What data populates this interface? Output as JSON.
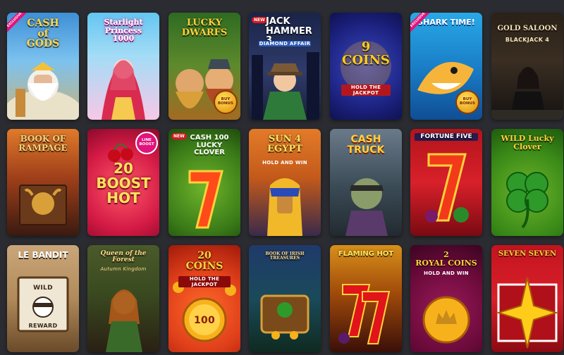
{
  "games": [
    {
      "id": "cash-of-gods",
      "title": "CASH\nof\nGODS",
      "badge": "EXCLUSIVE"
    },
    {
      "id": "starlight-princess-1000",
      "title": "Starlight\nPrincess\n1000"
    },
    {
      "id": "lucky-dwarfs",
      "title": "LUCKY\nDWARFS",
      "bonus": "BUY\nBONUS"
    },
    {
      "id": "jack-hammer-3",
      "title": "JACK\nHAMMER 3",
      "subtitle": "DIAMOND AFFAIR",
      "new": "NEW"
    },
    {
      "id": "9-coins",
      "title": "9\nCOINS",
      "subtitle": "HOLD THE JACKPOT"
    },
    {
      "id": "shark-time",
      "title": "SHARK TIME!",
      "badge": "EXCLUSIVE",
      "bonus": "BUY\nBONUS"
    },
    {
      "id": "gold-saloon-blackjack-4",
      "title": "GOLD SALOON",
      "subtitle": "BLACKJACK 4"
    },
    {
      "id": "book-of-rampage",
      "title": "BOOK OF\nRAMPAGE"
    },
    {
      "id": "20-boost-hot",
      "title": "20\nBOOST\nHOT",
      "boost": "LINE\nBOOST"
    },
    {
      "id": "cash-100-lucky-clover",
      "title": "CASH 100\nLUCKY CLOVER",
      "new": "NEW"
    },
    {
      "id": "sun-of-egypt-4",
      "title": "SUN 4\nEGYPT",
      "subtitle": "HOLD AND WIN"
    },
    {
      "id": "cash-truck",
      "title": "CASH\nTRUCK"
    },
    {
      "id": "fortune-five",
      "title": "FORTUNE FIVE"
    },
    {
      "id": "wild-lucky-clover",
      "title": "WILD Lucky\nClover"
    },
    {
      "id": "le-bandit",
      "title": "LE BANDIT",
      "sign_word1": "WILD",
      "sign_word2": "REWARD"
    },
    {
      "id": "queen-of-the-forest",
      "title": "Queen of the Forest",
      "subtitle": "Autumn Kingdom"
    },
    {
      "id": "20-coins",
      "title": "20\nCOINS",
      "subtitle": "HOLD THE JACKPOT",
      "coin_value": "100"
    },
    {
      "id": "book-of-irish-treasures",
      "title": "BOOK OF IRISH TREASURES"
    },
    {
      "id": "flaming-hot",
      "title": "FLAMING HOT"
    },
    {
      "id": "2-royal-coins",
      "title": "2\nROYAL COINS",
      "subtitle": "HOLD AND WIN"
    },
    {
      "id": "seven-seven",
      "title": "SEVEN SEVEN"
    }
  ]
}
